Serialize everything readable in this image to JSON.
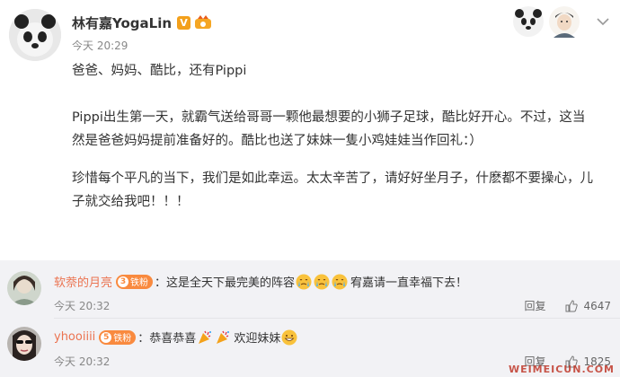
{
  "post": {
    "author": "林有嘉YogaLin",
    "verified_mark": "V",
    "time": "今天 20:29",
    "paragraphs": [
      "爸爸、妈妈、酷比，还有Pippi",
      "Pippi出生第一天，就霸气送给哥哥一颗他最想要的小狮子足球，酷比好开心。不过，这当然是爸爸妈妈提前准备好的。酷比也送了妹妹一隻小鸡娃娃当作回礼：）",
      "珍惜每个平凡的当下，我们是如此幸运。太太辛苦了，请好好坐月子，什麽都不要操心，儿子就交给我吧！！！"
    ]
  },
  "comments": [
    {
      "user": "软萘的月亮",
      "badge_level": "3",
      "badge_text": "铁粉",
      "text_before": "：这是全天下最完美的阵容",
      "text_after": "宥嘉请一直幸福下去！",
      "time": "今天 20:32",
      "reply_label": "回复",
      "likes": "4647"
    },
    {
      "user": "yhooiiii",
      "badge_level": "5",
      "badge_text": "铁粉",
      "text_before": "：恭喜恭喜",
      "text_after": "欢迎妹妹",
      "time": "今天 20:32",
      "reply_label": "回复",
      "likes": "1825"
    }
  ],
  "watermark": "WEIMEICUN.COM",
  "colors": {
    "username": "#eb7350",
    "fan_badge": "#f98a3f",
    "verified": "#f3a01b",
    "comment_bg": "#f2f2f5"
  }
}
